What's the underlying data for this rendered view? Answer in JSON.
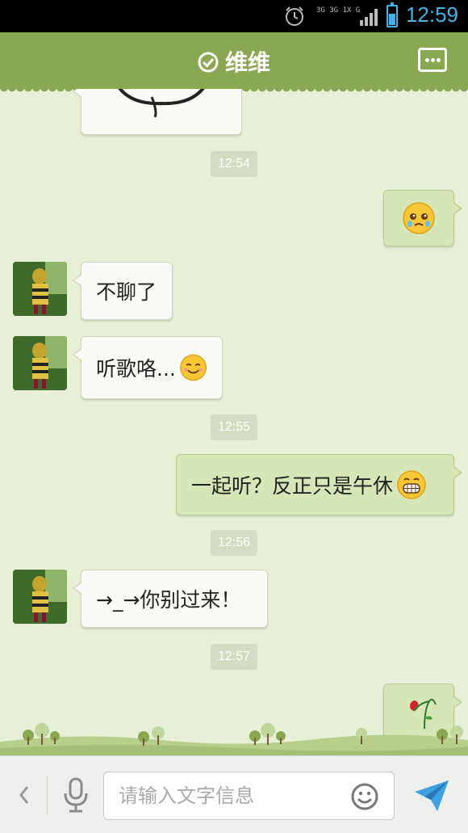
{
  "status_bar": {
    "time": "12:59",
    "network_label_top": "3G 3G 1X G",
    "alarm_icon": "alarm-clock-icon",
    "battery_level": 0.6
  },
  "header": {
    "title": "维维",
    "verified_icon": "check-circle-icon",
    "menu_icon": "more-dots-icon"
  },
  "messages": [
    {
      "kind": "image",
      "from": "them",
      "content": "sticker-face"
    },
    {
      "kind": "timestamp",
      "text": "12:54"
    },
    {
      "kind": "emoji",
      "from": "me",
      "content": "crying-face-emoji"
    },
    {
      "kind": "text",
      "from": "them",
      "text": "不聊了"
    },
    {
      "kind": "text",
      "from": "them",
      "text": "听歌咯...",
      "emoji": "smile-emoji"
    },
    {
      "kind": "timestamp",
      "text": "12:55"
    },
    {
      "kind": "text",
      "from": "me",
      "text": "一起听？反正只是午休",
      "emoji": "grin-emoji"
    },
    {
      "kind": "timestamp",
      "text": "12:56"
    },
    {
      "kind": "text",
      "from": "them",
      "text": "→_→你别过来！"
    },
    {
      "kind": "timestamp",
      "text": "12:57"
    },
    {
      "kind": "emoji",
      "from": "me",
      "content": "wilted-rose-emoji"
    }
  ],
  "input": {
    "placeholder": "请输入文字信息",
    "back_icon": "chevron-left-icon",
    "mic_icon": "microphone-icon",
    "emoji_icon": "smiley-icon",
    "send_icon": "send-arrow-icon"
  },
  "colors": {
    "header": "#8aa852",
    "background": "#e7efd6",
    "outgoing_bubble": "#d7e6b6",
    "incoming_bubble": "#fafaf6",
    "accent_blue": "#3fb4e8"
  }
}
